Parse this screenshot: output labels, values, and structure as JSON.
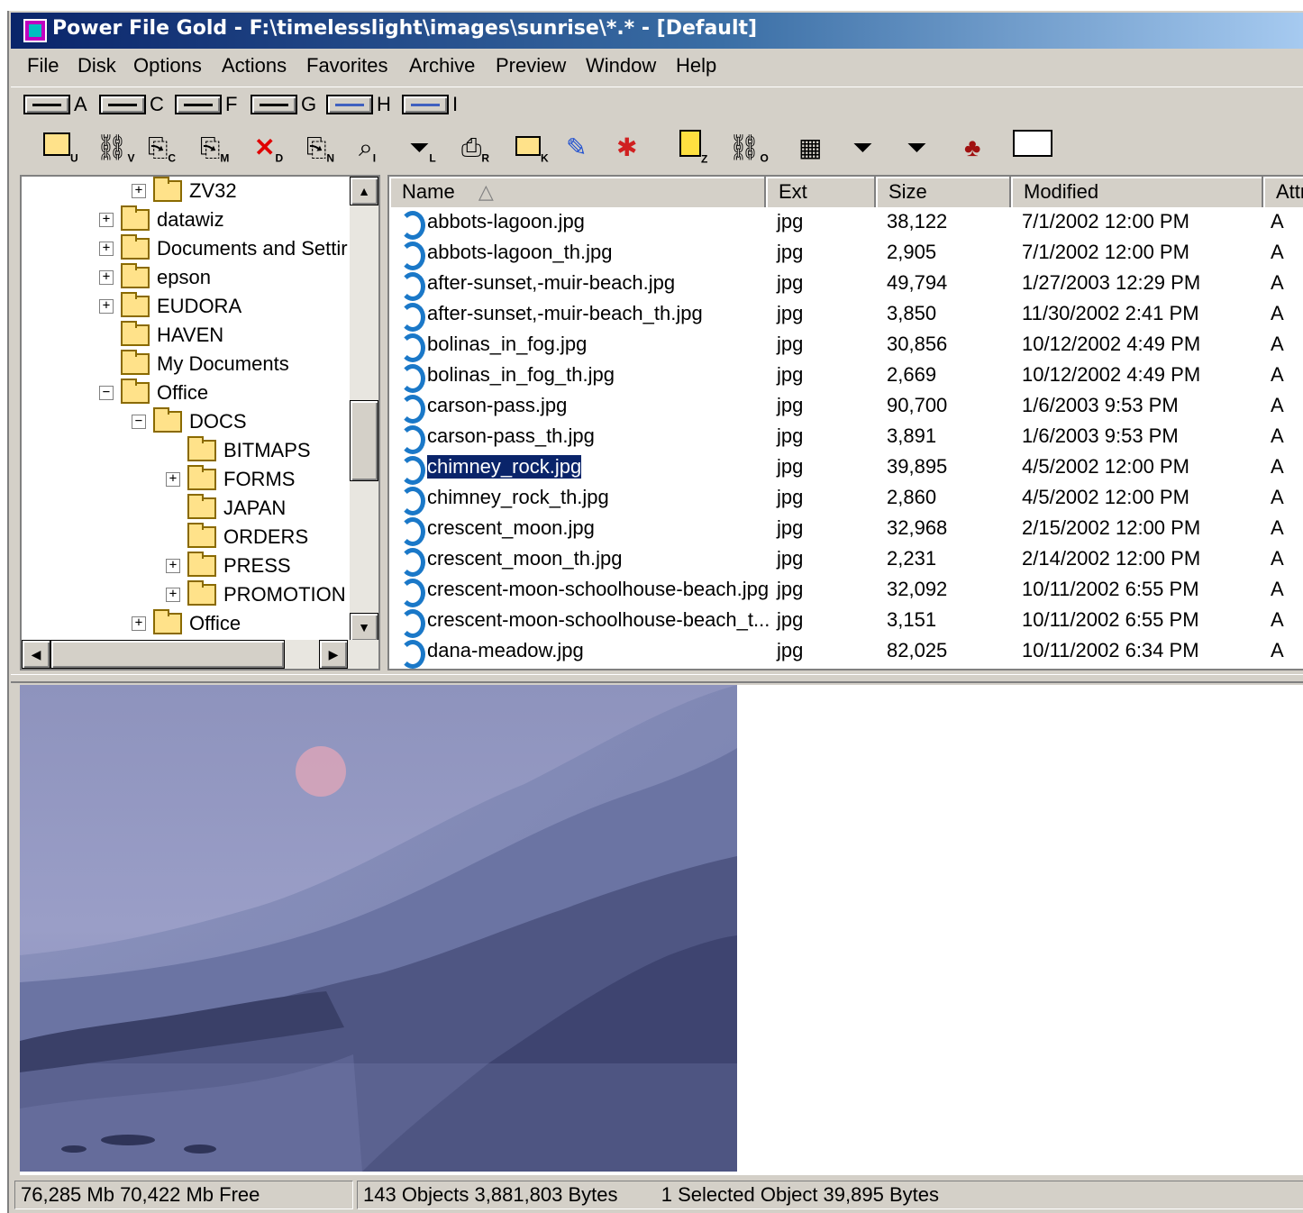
{
  "window": {
    "title": "Power File Gold  -  F:\\timelesslight\\images\\sunrise\\*.*  -  [Default]"
  },
  "menu": [
    "File",
    "Disk",
    "Options",
    "Actions",
    "Favorites",
    "Archive",
    "Preview",
    "Window",
    "Help"
  ],
  "drives": [
    {
      "letter": "A",
      "type": "floppy"
    },
    {
      "letter": "C",
      "type": "hard-disk"
    },
    {
      "letter": "F",
      "type": "hard-disk"
    },
    {
      "letter": "G",
      "type": "hard-disk"
    },
    {
      "letter": "H",
      "type": "network"
    },
    {
      "letter": "I",
      "type": "network"
    }
  ],
  "toolbar": [
    {
      "icon": "up-folder-icon",
      "key": "U"
    },
    {
      "icon": "binoculars-icon",
      "key": "V"
    },
    {
      "icon": "copy-icon",
      "key": "C"
    },
    {
      "icon": "move-icon",
      "key": "M"
    },
    {
      "icon": "delete-icon",
      "key": "D"
    },
    {
      "icon": "new-icon",
      "key": "N"
    },
    {
      "icon": "inspect-icon",
      "key": "I"
    },
    {
      "icon": "filter-icon",
      "key": "L"
    },
    {
      "icon": "print-icon",
      "key": "R"
    },
    {
      "icon": "make-folder-icon",
      "key": "K"
    },
    {
      "icon": "wand-icon",
      "key": ""
    },
    {
      "icon": "clear-icon",
      "key": ""
    },
    {
      "icon": "zip-icon",
      "key": "Z"
    },
    {
      "icon": "find-icon",
      "key": "O"
    },
    {
      "icon": "view-options-icon",
      "key": ""
    },
    {
      "icon": "set-filter-w-icon",
      "key": ""
    },
    {
      "icon": "set-filter-d-icon",
      "key": ""
    },
    {
      "icon": "tree-size-icon",
      "key": ""
    },
    {
      "icon": "command-icon",
      "key": ""
    }
  ],
  "tree": [
    {
      "label": "ZV32",
      "level": 3,
      "expander": "+"
    },
    {
      "label": "datawiz",
      "level": 2,
      "expander": "+"
    },
    {
      "label": "Documents and Settir",
      "level": 2,
      "expander": "+"
    },
    {
      "label": "epson",
      "level": 2,
      "expander": "+"
    },
    {
      "label": "EUDORA",
      "level": 2,
      "expander": "+"
    },
    {
      "label": "HAVEN",
      "level": 2,
      "expander": ""
    },
    {
      "label": "My Documents",
      "level": 2,
      "expander": ""
    },
    {
      "label": "Office",
      "level": 2,
      "expander": "-"
    },
    {
      "label": "DOCS",
      "level": 3,
      "expander": "-"
    },
    {
      "label": "BITMAPS",
      "level": 4,
      "expander": ""
    },
    {
      "label": "FORMS",
      "level": 4,
      "expander": "+"
    },
    {
      "label": "JAPAN",
      "level": 4,
      "expander": ""
    },
    {
      "label": "ORDERS",
      "level": 4,
      "expander": ""
    },
    {
      "label": "PRESS",
      "level": 4,
      "expander": "+"
    },
    {
      "label": "PROMOTION",
      "level": 4,
      "expander": "+"
    },
    {
      "label": "Office",
      "level": 3,
      "expander": "+"
    }
  ],
  "columns": {
    "name": "Name",
    "ext": "Ext",
    "size": "Size",
    "modified": "Modified",
    "attr": "Attr"
  },
  "files": [
    {
      "name": "abbots-lagoon.jpg",
      "ext": "jpg",
      "size": "38,122",
      "modified": "7/1/2002  12:00 PM",
      "attr": "A"
    },
    {
      "name": "abbots-lagoon_th.jpg",
      "ext": "jpg",
      "size": "2,905",
      "modified": "7/1/2002  12:00 PM",
      "attr": "A"
    },
    {
      "name": "after-sunset,-muir-beach.jpg",
      "ext": "jpg",
      "size": "49,794",
      "modified": "1/27/2003  12:29 PM",
      "attr": "A"
    },
    {
      "name": "after-sunset,-muir-beach_th.jpg",
      "ext": "jpg",
      "size": "3,850",
      "modified": "11/30/2002  2:41 PM",
      "attr": "A"
    },
    {
      "name": "bolinas_in_fog.jpg",
      "ext": "jpg",
      "size": "30,856",
      "modified": "10/12/2002  4:49 PM",
      "attr": "A"
    },
    {
      "name": "bolinas_in_fog_th.jpg",
      "ext": "jpg",
      "size": "2,669",
      "modified": "10/12/2002  4:49 PM",
      "attr": "A"
    },
    {
      "name": "carson-pass.jpg",
      "ext": "jpg",
      "size": "90,700",
      "modified": "1/6/2003  9:53 PM",
      "attr": "A"
    },
    {
      "name": "carson-pass_th.jpg",
      "ext": "jpg",
      "size": "3,891",
      "modified": "1/6/2003  9:53 PM",
      "attr": "A"
    },
    {
      "name": "chimney_rock.jpg",
      "ext": "jpg",
      "size": "39,895",
      "modified": "4/5/2002  12:00 PM",
      "attr": "A",
      "selected": true
    },
    {
      "name": "chimney_rock_th.jpg",
      "ext": "jpg",
      "size": "2,860",
      "modified": "4/5/2002  12:00 PM",
      "attr": "A"
    },
    {
      "name": "crescent_moon.jpg",
      "ext": "jpg",
      "size": "32,968",
      "modified": "2/15/2002  12:00 PM",
      "attr": "A"
    },
    {
      "name": "crescent_moon_th.jpg",
      "ext": "jpg",
      "size": "2,231",
      "modified": "2/14/2002  12:00 PM",
      "attr": "A"
    },
    {
      "name": "crescent-moon-schoolhouse-beach.jpg",
      "ext": "jpg",
      "size": "32,092",
      "modified": "10/11/2002  6:55 PM",
      "attr": "A"
    },
    {
      "name": "crescent-moon-schoolhouse-beach_t...",
      "ext": "jpg",
      "size": "3,151",
      "modified": "10/11/2002  6:55 PM",
      "attr": "A"
    },
    {
      "name": "dana-meadow.jpg",
      "ext": "jpg",
      "size": "82,025",
      "modified": "10/11/2002  6:34 PM",
      "attr": "A"
    }
  ],
  "status": {
    "disk": "76,285 Mb   70,422 Mb Free",
    "objects": "143 Objects  3,881,803  Bytes",
    "selection": "1 Selected Object   39,895 Bytes"
  }
}
